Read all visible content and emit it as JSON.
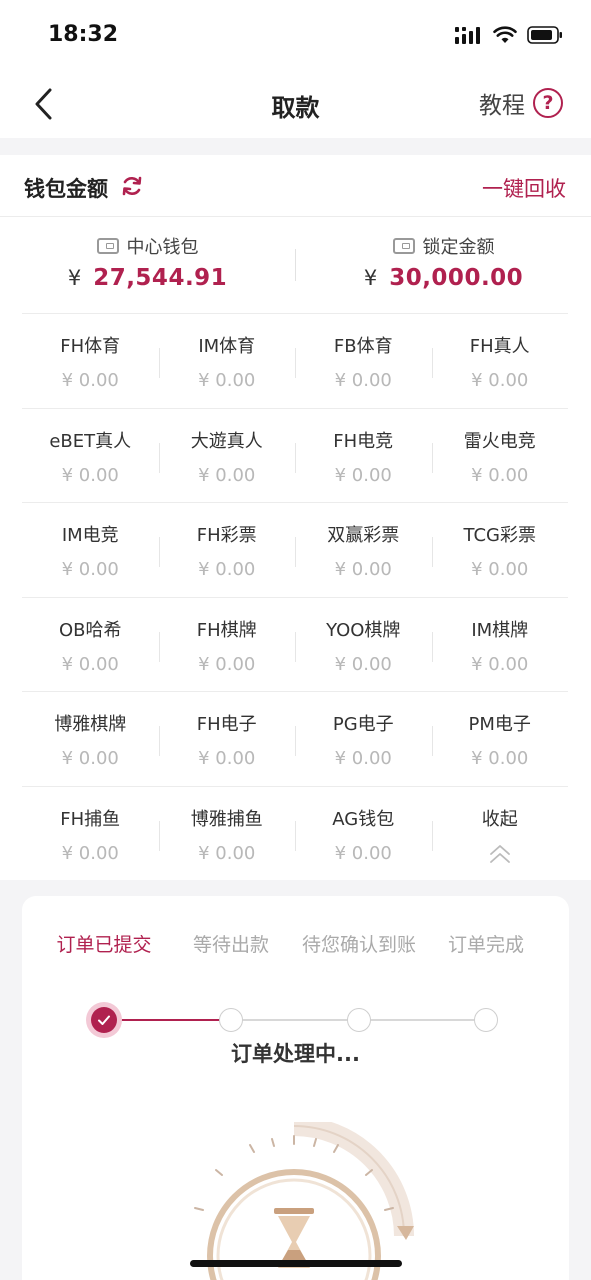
{
  "status_bar": {
    "time": "18:32"
  },
  "nav": {
    "title": "取款",
    "tutorial_label": "教程",
    "help_symbol": "?"
  },
  "wallet": {
    "title": "钱包金额",
    "recycle_label": "一键回收",
    "currency_symbol": "¥",
    "center_wallet": {
      "label": "中心钱包",
      "amount": "27,544.91"
    },
    "locked_amount": {
      "label": "锁定金额",
      "amount": "30,000.00"
    },
    "venues": [
      [
        {
          "name": "FH体育",
          "amount": "¥ 0.00"
        },
        {
          "name": "IM体育",
          "amount": "¥ 0.00"
        },
        {
          "name": "FB体育",
          "amount": "¥ 0.00"
        },
        {
          "name": "FH真人",
          "amount": "¥ 0.00"
        }
      ],
      [
        {
          "name": "eBET真人",
          "amount": "¥ 0.00"
        },
        {
          "name": "大遊真人",
          "amount": "¥ 0.00"
        },
        {
          "name": "FH电竞",
          "amount": "¥ 0.00"
        },
        {
          "name": "雷火电竞",
          "amount": "¥ 0.00"
        }
      ],
      [
        {
          "name": "IM电竞",
          "amount": "¥ 0.00"
        },
        {
          "name": "FH彩票",
          "amount": "¥ 0.00"
        },
        {
          "name": "双赢彩票",
          "amount": "¥ 0.00"
        },
        {
          "name": "TCG彩票",
          "amount": "¥ 0.00"
        }
      ],
      [
        {
          "name": "OB哈希",
          "amount": "¥ 0.00"
        },
        {
          "name": "FH棋牌",
          "amount": "¥ 0.00"
        },
        {
          "name": "YOO棋牌",
          "amount": "¥ 0.00"
        },
        {
          "name": "IM棋牌",
          "amount": "¥ 0.00"
        }
      ],
      [
        {
          "name": "博雅棋牌",
          "amount": "¥ 0.00"
        },
        {
          "name": "FH电子",
          "amount": "¥ 0.00"
        },
        {
          "name": "PG电子",
          "amount": "¥ 0.00"
        },
        {
          "name": "PM电子",
          "amount": "¥ 0.00"
        }
      ],
      [
        {
          "name": "FH捕鱼",
          "amount": "¥ 0.00"
        },
        {
          "name": "博雅捕鱼",
          "amount": "¥ 0.00"
        },
        {
          "name": "AG钱包",
          "amount": "¥ 0.00"
        }
      ]
    ],
    "collapse_label": "收起"
  },
  "order": {
    "steps": [
      "订单已提交",
      "等待出款",
      "待您确认到账",
      "订单完成"
    ],
    "current_step": 1,
    "processing_text": "订单处理中..."
  },
  "colors": {
    "accent": "#b0214f",
    "muted": "#b8b8b8",
    "gold": "#c9a07e"
  }
}
